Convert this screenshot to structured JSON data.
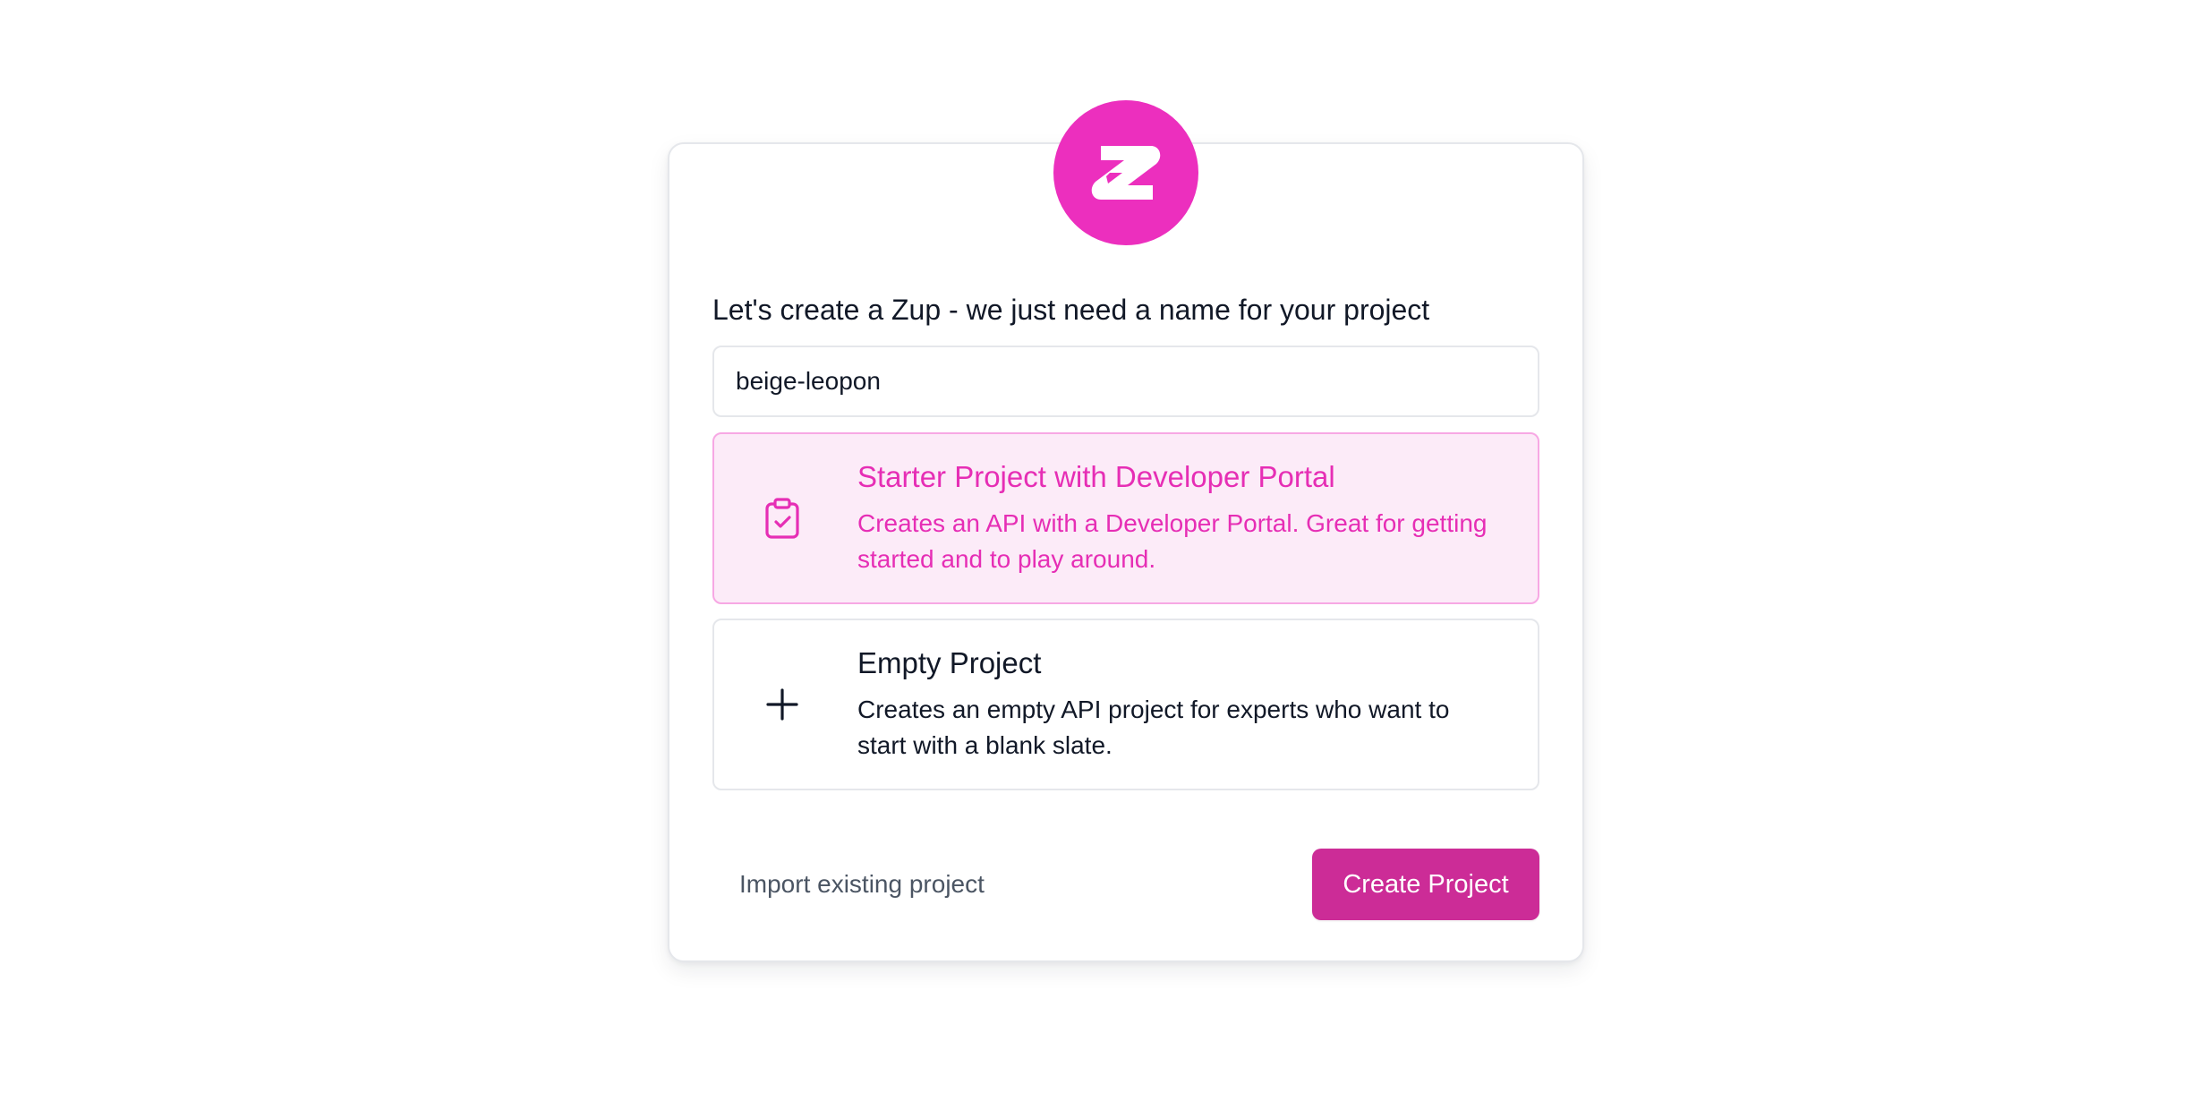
{
  "colors": {
    "brand": "#ec2fbe",
    "selected_bg": "#fcebf8",
    "selected_text": "#e62eb5",
    "primary_button": "#cc2c97"
  },
  "logo": {
    "icon": "zuplo-logo-icon"
  },
  "form": {
    "heading": "Let's create a Zup - we just need a name for your project",
    "project_name_value": "beige-leopon"
  },
  "options": [
    {
      "icon": "clipboard-check-icon",
      "title": "Starter Project with Developer Portal",
      "description": "Creates an API with a Developer Portal. Great for getting started and to play around.",
      "selected": true
    },
    {
      "icon": "plus-icon",
      "title": "Empty Project",
      "description": "Creates an empty API project for experts who want to start with a blank slate.",
      "selected": false
    }
  ],
  "footer": {
    "import_label": "Import existing project",
    "create_label": "Create Project"
  }
}
